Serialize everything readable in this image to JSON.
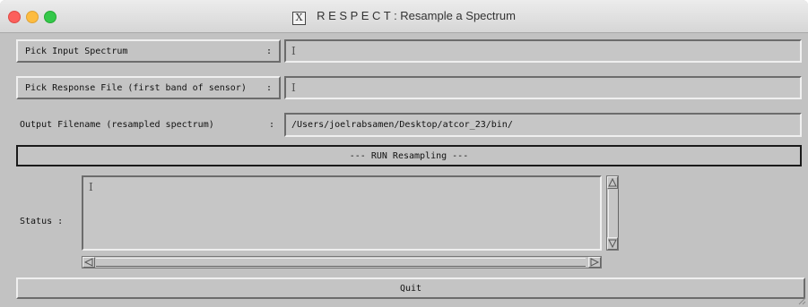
{
  "window": {
    "title": "R E S P E C T :  Resample a Spectrum",
    "x_icon": "X"
  },
  "form": {
    "pick_input_label": "Pick Input Spectrum",
    "pick_input_sep": ":",
    "input_spectrum_value": "",
    "pick_response_label": "Pick Response File  (first band of sensor)",
    "pick_response_sep": ":",
    "response_file_value": "",
    "output_label": "Output Filename (resampled spectrum)",
    "output_sep": ":",
    "output_value": "/Users/joelrabsamen/Desktop/atcor_23/bin/"
  },
  "run_button": "--- RUN Resampling  ---",
  "status": {
    "label": "Status  :",
    "text": ""
  },
  "quit_button": "Quit",
  "icons": {
    "text_cursor": "I",
    "window_icon": "x-window-icon",
    "scroll_up": "up-arrow-icon",
    "scroll_down": "down-arrow-icon",
    "scroll_left": "left-arrow-icon",
    "scroll_right": "right-arrow-icon"
  },
  "colors": {
    "window_bg": "#c2c2c2",
    "traffic_close": "#fc605c",
    "traffic_min": "#fdbc40",
    "traffic_max": "#34c84a"
  }
}
